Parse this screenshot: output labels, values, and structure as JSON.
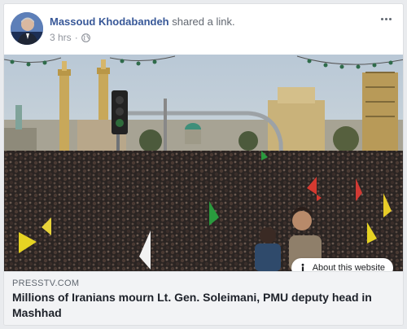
{
  "post": {
    "author_name": "Massoud Khodabandeh",
    "action": " shared a link.",
    "timestamp": "3 hrs",
    "separator": "·",
    "privacy_icon": "globe-icon",
    "more_icon": "more-options-icon"
  },
  "link": {
    "domain": "PRESSTV.COM",
    "title": "Millions of Iranians mourn Lt. Gen. Soleimani, PMU deputy head in Mashhad",
    "about_label": "About this website",
    "about_icon": "info-icon"
  },
  "colors": {
    "author": "#385898",
    "link_box_bg": "#f2f3f5",
    "sky": "#c9d6e2",
    "crowd": "#2a2422"
  }
}
